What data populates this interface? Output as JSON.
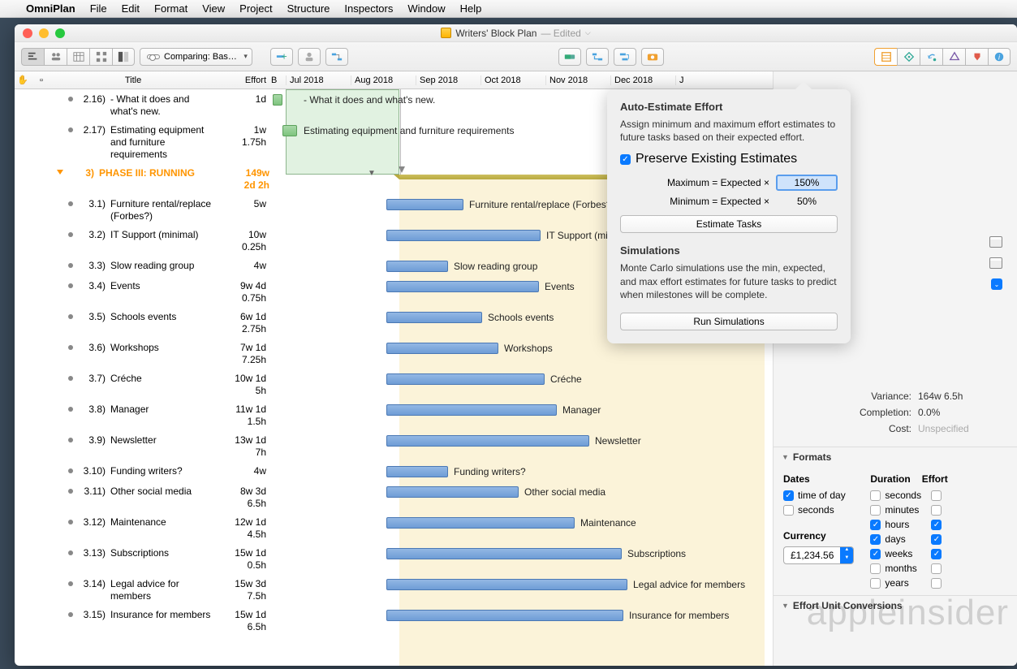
{
  "menubar": {
    "app": "OmniPlan",
    "items": [
      "File",
      "Edit",
      "Format",
      "View",
      "Project",
      "Structure",
      "Inspectors",
      "Window",
      "Help"
    ]
  },
  "window": {
    "title": "Writers' Block Plan",
    "edited": "— Edited"
  },
  "toolbar": {
    "comparing": "Comparing: Bas…"
  },
  "columns": {
    "title": "Title",
    "effort": "Effort",
    "b": "B"
  },
  "timeline": {
    "months": [
      "Jul 2018",
      "Aug 2018",
      "Sep 2018",
      "Oct 2018",
      "Nov 2018",
      "Dec 2018",
      "J"
    ]
  },
  "tasks": [
    {
      "num": "2.16)",
      "title": "- What it does and what's new.",
      "effort": "1d",
      "barLabel": " - What it does and what's new.",
      "barStart": 0,
      "barLen": 12,
      "red": true,
      "green": true,
      "labelX": 38
    },
    {
      "num": "2.17)",
      "title": "Estimating equipment and furniture requirements",
      "effort": "1w 1.75h",
      "barLabel": "Estimating equipment and furniture requirements",
      "barStart": 12,
      "barLen": 18,
      "green": true,
      "labelX": 38
    },
    {
      "phase": true,
      "num": "3)",
      "title": "PHASE III: RUNNING",
      "effort": "149w 2d 2h",
      "disclosureX": 113
    },
    {
      "num": "3.1)",
      "title": "Furniture rental/replace (Forbes?)",
      "effort": "5w",
      "barLabel": "Furniture rental/replace (Forbes?)",
      "barStart": 140,
      "barLen": 95,
      "labelX": 242
    },
    {
      "num": "3.2)",
      "title": "IT Support (minimal)",
      "effort": "10w 0.25h",
      "barLabel": "IT Support (minimal)",
      "barStart": 140,
      "barLen": 190,
      "labelX": 337
    },
    {
      "num": "3.3)",
      "title": "Slow reading group",
      "effort": "4w",
      "barLabel": "Slow reading group",
      "barStart": 140,
      "barLen": 76,
      "labelX": 223
    },
    {
      "num": "3.4)",
      "title": "Events",
      "effort": "9w 4d 0.75h",
      "barLabel": "Events",
      "barStart": 140,
      "barLen": 188,
      "labelX": 335
    },
    {
      "num": "3.5)",
      "title": "Schools events",
      "effort": "6w 1d 2.75h",
      "barLabel": "Schools events",
      "barStart": 140,
      "barLen": 118,
      "labelX": 265
    },
    {
      "num": "3.6)",
      "title": "Workshops",
      "effort": "7w 1d 7.25h",
      "barLabel": "Workshops",
      "barStart": 140,
      "barLen": 138,
      "labelX": 285
    },
    {
      "num": "3.7)",
      "title": "Créche",
      "effort": "10w 1d 5h",
      "barLabel": "Créche",
      "barStart": 140,
      "barLen": 195,
      "labelX": 342
    },
    {
      "num": "3.8)",
      "title": "Manager",
      "effort": "11w 1d 1.5h",
      "barLabel": "Manager",
      "barStart": 140,
      "barLen": 210,
      "labelX": 357
    },
    {
      "num": "3.9)",
      "title": "Newsletter",
      "effort": "13w 1d 7h",
      "barLabel": "Newsletter",
      "barStart": 140,
      "barLen": 250,
      "labelX": 397
    },
    {
      "num": "3.10)",
      "title": "Funding writers?",
      "effort": "4w",
      "barLabel": "Funding writers?",
      "barStart": 140,
      "barLen": 76,
      "labelX": 223
    },
    {
      "num": "3.11)",
      "title": "Other social media",
      "effort": "8w 3d 6.5h",
      "barLabel": "Other social media",
      "barStart": 140,
      "barLen": 163,
      "labelX": 310
    },
    {
      "num": "3.12)",
      "title": "Maintenance",
      "effort": "12w 1d 4.5h",
      "barLabel": "Maintenance",
      "barStart": 140,
      "barLen": 232,
      "labelX": 379
    },
    {
      "num": "3.13)",
      "title": "Subscriptions",
      "effort": "15w 1d 0.5h",
      "barLabel": "Subscriptions",
      "barStart": 140,
      "barLen": 290,
      "labelX": 437
    },
    {
      "num": "3.14)",
      "title": "Legal advice for members",
      "effort": "15w 3d 7.5h",
      "barLabel": "Legal advice for members",
      "barStart": 140,
      "barLen": 297,
      "labelX": 444
    },
    {
      "num": "3.15)",
      "title": "Insurance for members",
      "effort": "15w 1d 6.5h",
      "barLabel": "Insurance for members",
      "barStart": 140,
      "barLen": 292,
      "labelX": 439
    }
  ],
  "popover": {
    "title": "Auto-Estimate Effort",
    "desc": "Assign minimum and maximum effort estimates to future tasks based on their expected effort.",
    "preserve": "Preserve Existing Estimates",
    "maxLabel": "Maximum = Expected ×",
    "maxVal": "150%",
    "minLabel": "Minimum = Expected ×",
    "minVal": "50%",
    "estimateBtn": "Estimate Tasks",
    "simTitle": "Simulations",
    "simDesc": "Monte Carlo simulations use the min, expected, and max effort estimates for future tasks to predict when milestones will be complete.",
    "runBtn": "Run Simulations"
  },
  "inspector": {
    "variance": {
      "k": "Variance:",
      "v": "164w 6.5h"
    },
    "completion": {
      "k": "Completion:",
      "v": "0.0%"
    },
    "cost": {
      "k": "Cost:",
      "v": "Unspecified"
    },
    "formats": "Formats",
    "dates": "Dates",
    "duration": "Duration",
    "effortHdr": "Effort",
    "timeofday": "time of day",
    "secondsD": "seconds",
    "seconds": "seconds",
    "minutes": "minutes",
    "hours": "hours",
    "days": "days",
    "weeks": "weeks",
    "months": "months",
    "years": "years",
    "currency": "Currency",
    "currencyVal": "£1,234.56",
    "effortUnit": "Effort Unit Conversions"
  },
  "watermark": "appleinsider"
}
